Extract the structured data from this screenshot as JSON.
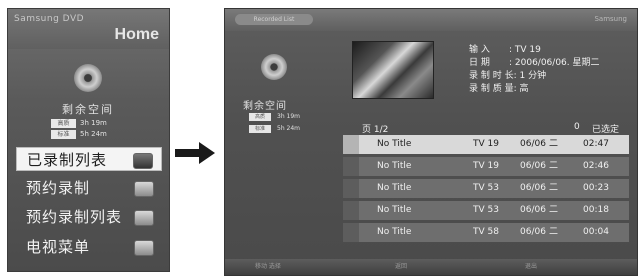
{
  "home_menu": {
    "brand": "Samsung DVD",
    "title": "Home",
    "space": {
      "title": "剩余空间",
      "rows": [
        {
          "label": "高质",
          "value": "3h 19m"
        },
        {
          "label": "标准",
          "value": "5h 24m"
        }
      ]
    },
    "items": [
      {
        "label": "已录制列表",
        "icon": "recorded-list-icon",
        "selected": true
      },
      {
        "label": "预约录制",
        "icon": "timer-record-icon",
        "selected": false
      },
      {
        "label": "预约录制列表",
        "icon": "timer-list-icon",
        "selected": false
      },
      {
        "label": "电视菜单",
        "icon": "tv-menu-icon",
        "selected": false
      }
    ]
  },
  "recorded_list": {
    "window_tag": "Recorded List",
    "brand": "Samsung",
    "space": {
      "title": "剩余空间",
      "rows": [
        {
          "label": "高质",
          "value": "3h 19m"
        },
        {
          "label": "标准",
          "value": "5h 24m"
        }
      ]
    },
    "info": [
      {
        "key": "输 入",
        "value": ": TV 19"
      },
      {
        "key": "日 期",
        "value": ": 2006/06/06. 星期二"
      },
      {
        "key": "录 制 时 长",
        "value": ": 1 分钟"
      },
      {
        "key": "录 制 质 量",
        "value": ": 高"
      }
    ],
    "page_label": "页",
    "page": "1/2",
    "selected_count": "0",
    "selected_label": "已选定",
    "rows": [
      {
        "title": "No Title",
        "channel": "TV 19",
        "date": "06/06",
        "weekday": "二",
        "duration": "02:47",
        "selected": true
      },
      {
        "title": "No Title",
        "channel": "TV 19",
        "date": "06/06",
        "weekday": "二",
        "duration": "02:46",
        "selected": false
      },
      {
        "title": "No Title",
        "channel": "TV 53",
        "date": "06/06",
        "weekday": "二",
        "duration": "00:23",
        "selected": false
      },
      {
        "title": "No Title",
        "channel": "TV 53",
        "date": "06/06",
        "weekday": "二",
        "duration": "00:18",
        "selected": false
      },
      {
        "title": "No Title",
        "channel": "TV 58",
        "date": "06/06",
        "weekday": "二",
        "duration": "00:04",
        "selected": false
      }
    ],
    "bottom_hints": [
      "移动 选择",
      "返回",
      "退出"
    ]
  },
  "colors": {
    "panel_bg": "#555555",
    "selected_row": "#d9d9d9",
    "row_bg": "#6e6e6e",
    "arrow": "#1a1a1a"
  }
}
